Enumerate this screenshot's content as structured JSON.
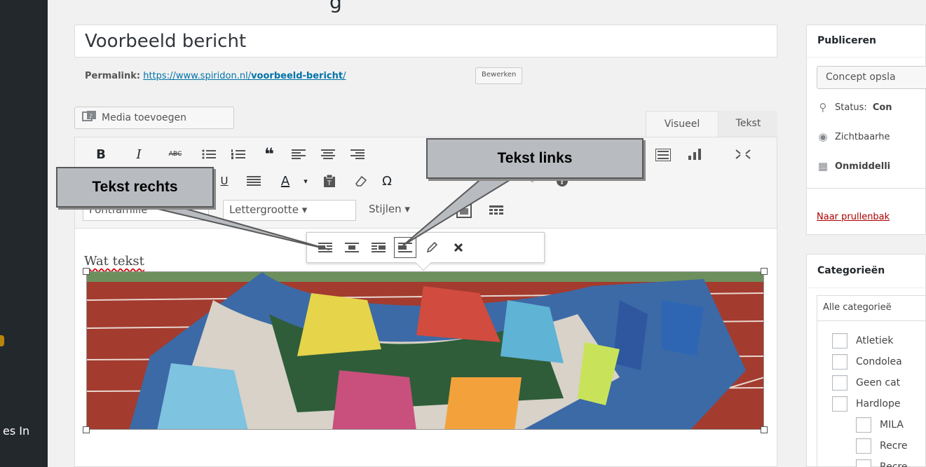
{
  "admin": {
    "menu_fragment": "es In"
  },
  "page": {
    "heading_fragment": "g"
  },
  "post": {
    "title": "Voorbeeld bericht",
    "permalink_label": "Permalink:",
    "permalink_base": "https://www.spiridon.nl/",
    "permalink_slug": "voorbeeld-bericht",
    "permalink_trail": "/",
    "edit_slug_button": "Bewerken"
  },
  "editor": {
    "add_media": "Media toevoegen",
    "tab_visual": "Visueel",
    "tab_text": "Tekst",
    "row1": [
      "B",
      "I",
      "ABC",
      "☰",
      "☷",
      "❝",
      "≡",
      "≡",
      "≡"
    ],
    "row2": [
      "U",
      "≣",
      "A",
      "▾",
      "▣",
      "◇",
      "Ω",
      "↶",
      "↷",
      "?"
    ],
    "font_family": "Fontfamilie",
    "font_size": "Lettergrootte",
    "styles": "Stijlen",
    "content_text": "Wat tekst"
  },
  "image_toolbar": {
    "buttons": [
      "align-left",
      "align-center",
      "align-right",
      "align-none",
      "edit",
      "remove"
    ]
  },
  "callouts": {
    "links": "Tekst links",
    "rechts": "Tekst rechts"
  },
  "publish": {
    "title": "Publiceren",
    "save_draft": "Concept opsla",
    "status_label": "Status:",
    "status_value": "Con",
    "visibility": "Zichtbaarhe",
    "schedule": "Onmiddelli",
    "trash": "Naar prullenbak"
  },
  "categories": {
    "title": "Categorieën",
    "tab_all": "Alle categorieë",
    "items": [
      {
        "label": "Atletiek",
        "level": 0
      },
      {
        "label": "Condolea",
        "level": 0
      },
      {
        "label": "Geen cat",
        "level": 0
      },
      {
        "label": "Hardlope",
        "level": 0
      },
      {
        "label": "MILA",
        "level": 1
      },
      {
        "label": "Recre",
        "level": 1
      },
      {
        "label": "Recre",
        "level": 1
      }
    ]
  },
  "colors": {
    "admin_bar": "#23282d",
    "link": "#0073aa",
    "trash": "#a00000",
    "callout_fill": "#b8bbbf",
    "track": "#a33b2f"
  }
}
